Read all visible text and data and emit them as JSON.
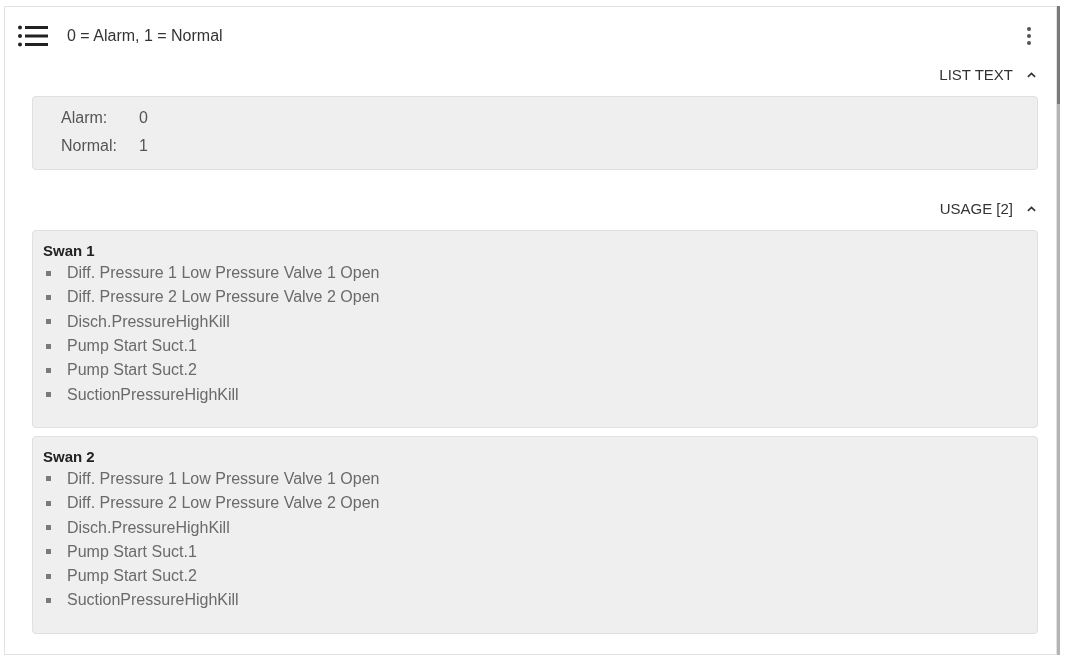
{
  "header": {
    "title": "0 = Alarm, 1 = Normal"
  },
  "sections": [
    {
      "kind": "list_text",
      "label": "LIST TEXT",
      "expanded": true,
      "entries": [
        {
          "label": "Alarm:",
          "value": "0"
        },
        {
          "label": "Normal:",
          "value": "1"
        }
      ]
    },
    {
      "kind": "usage",
      "label": "USAGE [2]",
      "expanded": true,
      "groups": [
        {
          "title": "Swan 1",
          "items": [
            "Diff. Pressure 1 Low Pressure Valve 1 Open",
            "Diff. Pressure 2 Low Pressure Valve 2 Open",
            "Disch.PressureHighKill",
            "Pump Start Suct.1",
            "Pump Start Suct.2",
            "SuctionPressureHighKill"
          ]
        },
        {
          "title": "Swan 2",
          "items": [
            "Diff. Pressure 1 Low Pressure Valve 1 Open",
            "Diff. Pressure 2 Low Pressure Valve 2 Open",
            "Disch.PressureHighKill",
            "Pump Start Suct.1",
            "Pump Start Suct.2",
            "SuctionPressureHighKill"
          ]
        }
      ]
    }
  ]
}
